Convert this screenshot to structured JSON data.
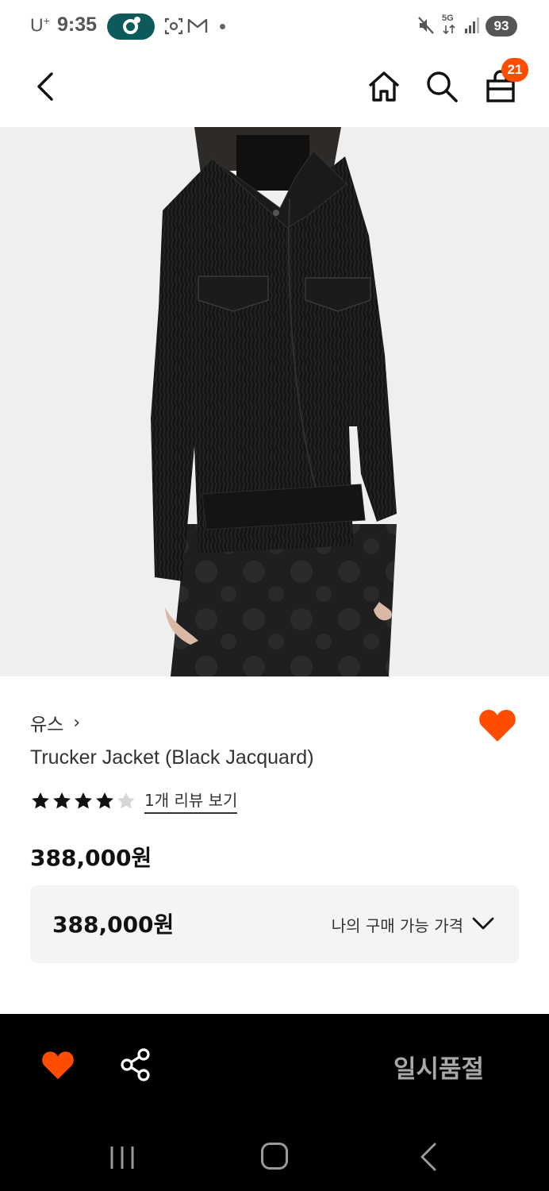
{
  "status_bar": {
    "carrier": "U",
    "carrier_sup": "+",
    "time": "9:35",
    "network": "5G",
    "battery": "93"
  },
  "header": {
    "cart_count": "21"
  },
  "product": {
    "brand": "유스",
    "brand_chevron": "›",
    "name": "Trucker Jacket (Black Jacquard)",
    "rating": 4,
    "rating_max": 5,
    "review_link": "1개 리뷰 보기",
    "price": "388,000원",
    "my_price_value": "388,000원",
    "my_price_label": "나의 구매 가능 가격"
  },
  "bottom_bar": {
    "soldout_label": "일시품절"
  },
  "colors": {
    "accent": "#ff4d00",
    "pill": "#0c5a5a",
    "bar": "#000000"
  },
  "icons": [
    "back-icon",
    "home-icon",
    "search-icon",
    "cart-icon",
    "heart-icon",
    "share-icon",
    "chevron-down-icon"
  ]
}
